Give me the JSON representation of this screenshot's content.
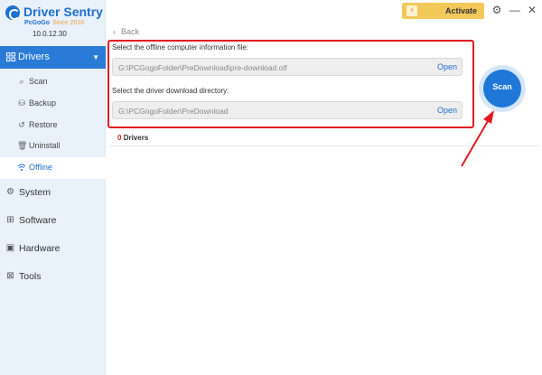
{
  "app": {
    "name": "Driver Sentry",
    "company": "PcGoGo",
    "since": "Since 2018",
    "version": "10.0.12.30"
  },
  "titlebar": {
    "activate_label": "Activate",
    "settings_icon": "gear-icon",
    "minimize_icon": "minimize-icon",
    "close_icon": "close-icon"
  },
  "sidebar": {
    "drivers_label": "Drivers",
    "sub_items": [
      {
        "label": "Scan",
        "icon": "search-icon"
      },
      {
        "label": "Backup",
        "icon": "backup-icon"
      },
      {
        "label": "Restore",
        "icon": "restore-icon"
      },
      {
        "label": "Uninstall",
        "icon": "trash-icon"
      },
      {
        "label": "Offline",
        "icon": "wifi-icon",
        "active": true
      }
    ],
    "main_items": [
      {
        "label": "System",
        "icon": "gear-icon"
      },
      {
        "label": "Software",
        "icon": "software-icon"
      },
      {
        "label": "Hardware",
        "icon": "chip-icon"
      },
      {
        "label": "Tools",
        "icon": "tools-icon"
      }
    ]
  },
  "content": {
    "back_label": "Back",
    "info_file_label": "Select the offline computer information file:",
    "info_file_path": "G:\\PCGogoFolder\\PreDownload\\pre-download.olf",
    "download_dir_label": "Select the driver download directory:",
    "download_dir_path": "G:\\PCGogoFolder\\PreDownload",
    "open_label": "Open",
    "drivers_count": "0",
    "drivers_count_suffix": "Drivers",
    "scan_label": "Scan"
  },
  "colors": {
    "accent": "#1f78d8",
    "highlight": "#e11b22",
    "activate": "#f3c85a"
  }
}
